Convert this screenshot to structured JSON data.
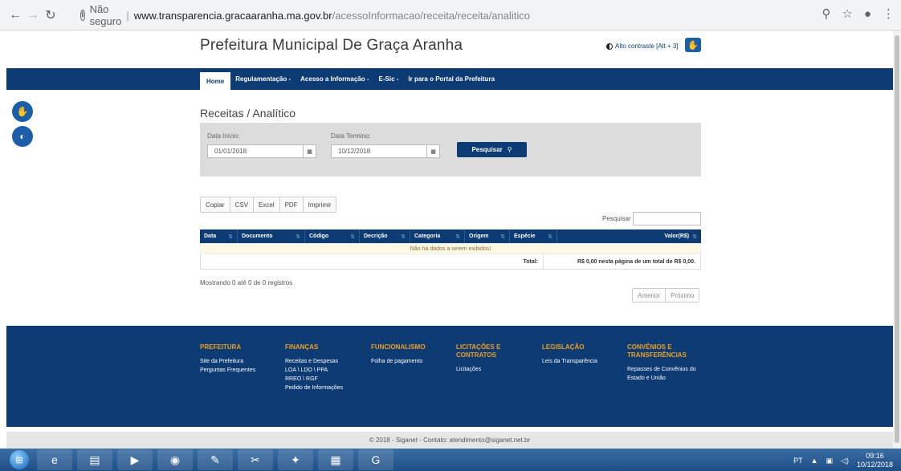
{
  "browser": {
    "not_secure": "Não seguro",
    "host": "www.transparencia.gracaaranha.ma.gov.br",
    "path": "/acessoInformacao/receita/receita/analitico"
  },
  "header": {
    "title": "Prefeitura Municipal De Graça Aranha",
    "contrast_label": "Alto contraste [Alt + 3]"
  },
  "nav": {
    "items": [
      "Home",
      "Regulamentação -",
      "Acesso a Informação -",
      "E-Sic -",
      "Ir para o Portal da Prefeitura"
    ]
  },
  "page": {
    "heading": "Receitas / Analítico"
  },
  "filters": {
    "start_label": "Data Início:",
    "start_value": "01/01/2018",
    "end_label": "Data Termino:",
    "end_value": "10/12/2018",
    "search_button": "Pesquisar"
  },
  "export_buttons": [
    "Copiar",
    "CSV",
    "Excel",
    "PDF",
    "Imprimir"
  ],
  "table_search_label": "Pesquisar",
  "table": {
    "columns": [
      "Data",
      "Documento",
      "Código",
      "Decrição",
      "Categoria",
      "Origem",
      "Espécie",
      "Valor(R$)"
    ],
    "empty_message": "Não há dados a serem exibidos!",
    "total_label": "Total:",
    "total_value": "R$ 0,00 nesta página de um total de R$ 0,00."
  },
  "showing": "Mostrando 0 até 0 de 0 registros",
  "pager": {
    "prev": "Anterior",
    "next": "Próximo"
  },
  "footer": {
    "columns": [
      {
        "title": "PREFEITURA",
        "links": [
          "Site da Prefeitura",
          "Perguntas Frequentes"
        ]
      },
      {
        "title": "FINANÇAS",
        "links": [
          "Receitas e Despesas",
          "LOA \\ LDO \\ PPA",
          "RREO \\ RGF",
          "Pedido de Informações"
        ]
      },
      {
        "title": "FUNCIONALISMO",
        "links": [
          "Folha de pagamento"
        ]
      },
      {
        "title": "LICITAÇÕES E CONTRATOS",
        "links": [
          "Licitações"
        ]
      },
      {
        "title": "LEGISLAÇÃO",
        "links": [
          "Leis da Transparência"
        ]
      },
      {
        "title": "CONVÊNIOS E TRANSFERÊNCIAS",
        "links": [
          "Repasses de Convênios do Estado e União"
        ]
      }
    ],
    "copyright": "© 2018 - Siganet - Contato: atendimento@siganet.net.br"
  },
  "taskbar": {
    "lang": "PT",
    "time": "09:16",
    "date": "10/12/2018"
  }
}
